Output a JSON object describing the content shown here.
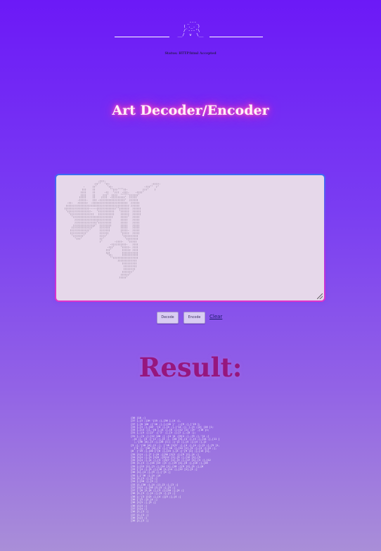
{
  "header": {
    "art": "  _---_\n ( ._. )\n /`---'\\\n__/  v  \\__",
    "status": "Status: HTTP/html Accepted"
  },
  "title": "Art Decoder/Encoder",
  "input": {
    "art": "                         .;;;.\n                      .;;''  ';;.                            .;;;;.\n               .     ;;'       ';;.                     .;;;''  ;'\n              ;;;    ;;          '';;;'''';;.          ;;;'    ;\n             ;;;;    ;;      .;;   ';;;  .;;;.    .;;;;'\n             ;;;;    ;;     ;;;'  ;;;;  '''''';;;;;;'\n            ;;;;;    ;;    ;;;;  .;;;;;;;;;'  ;;;;;\n           .;;;;;.   ;;; .;;;;;;;;;;;;;;;;;'  ;;;;;;\n    .;;.   ;;;;;;;  .;;;;;;;;;;;;;;;;;;;;;;;;  ;;;;;;\n   ;;;;;;;;;;;;;;;;;;;;;;;;;;;;;;;;;;;;;;;;;;; ;;;;;;\n  ;;;;;;;;;;;;;;;;;.....;;;;;;;;;;;;;'';;;;;;;  ;;;;;;\n   ';;;;;;;;;;;;;;;;.   ';;;;;;;;;;;   ';;;;;;  ;;;;;;\n     ';;;;;;;;;;;;;;;;   ;;;;;;;;;;;    ;;;;;;  ;;;;;;\n       ';;;;;;;;;;;;;;;;;;;;;;;;;;;     ;;;;;'  ;;;;;\n         ;;;;;;;;;;;;;;;;;;;;;;;;;      ;;;;;   ;;;;;\n         ;;;;;;;;;;;;;;;';;;;;;;;;      ;;;;;   ;;;;;\n        ;;;;;;;;;;;;;;;'  ;;;;;;;;      ;;;;;   ;;;;;\n       ;;;;;;;;;;;;;;'    ;;;;;;;       ;;;;;   ;;;;;\n      ;;;;;;;;;;;;;'      ;;;;;;;       ;;;;;.  ;;;;;\n      ;;;;;;;;;;;'        ;;;;;;        ';;;;;  ;;;;;\n       ';;;;;;;'          ;;;;'          ';;;;;;;;;;\n         ';;;'            ;;'              ';;;;;;;;\n                          ;'        .;;;;.   ';;;;;\n                                 .;;;;;;;;;;.   ;;;;\n                               .;;;'    ';;;;;. ;;;;\n                              ;;;'       ;;;;;; ;;;;\n                              ;;;        ;;;;;;;;;;;\n                               ';;.      ;;;;;;;;;;;\n                                 '';;;;;;;;;;;;;;;;;\n                                      ;;;;;;;;;;;;;\n                                         ;;;;;;;;;;\n                                          ;;;;;;;;;\n                                          ;;;;;;;;\n                                         ;;;;;;;'\n                                        ;;;;;;'\n                                       ;;;;;'"
  },
  "buttons": {
    "decode": "Decode",
    "encode": "Encode",
    "clear": "Clear"
  },
  "result": {
    "heading": "Result:",
    "output": "[36 ]18 ;]\n[37 ],[3 ;]1H '[15 ;],[36 ],[4 ;],\n[37 ],[8 ]20 ;['16 ;],[;[20 ]'  ;;[9 ;],['19 ];\n[33 ],[3 ;],[16' '[4 ;],[4 ;],['14 ;]; ],[3 ;]2[ [16 ]1;\n[33 ],[13 ;]],'[6 ],[4 ;],[6 ;];[12 ]1[ ;[5' ,[10 ]1;\n[31 ],;[5 ;];[2' ;['2' ;],[3 ;];[7 ],;[5 ;];\n[31 ],;[5 ;];[12 ]20 ;[ ;[4 ]4 ;]5[4 ;],;[9 ;],'[4 ;]\n ,[4 ;], [3 ;]'[2 ;],[3 ;], [20 ]3],[4 ;],[3 ;],[14 ;],[11 ]\n  ;,'[30 ]4],[3 ;],[20 ]1;[ ;['[2 ;],[5 ;];[4 ;],[2\n[3 ;],'[10 ]4],[2 ;], ['18 ]1[3' ;],[4 ;],[4 ;];[2 ;],[9 ]1,\n  ['4 ;],'[16 ]4],[3 ;],['16 ;],[14 ]1],[5 ;],[4 ;];[4 ;],\n[6  ['19 ;],[20 ]'[6 ;],[15 ],[3 ;]'[9 ]1[ ;],[13 ]1],\n[35 ]1[4 ;],[7 ]:[6 ;][30 ]1[2 ;];[9 ]1],[4 ;]\n[34 ]1[4 ;],[3 ]1[6 ;]3[12 ]1],[3 ;],[12 ]1],[3\n[35 ]1[4 ;],[4 ;],[3 ;]3[7 ]1],[3 ;],[17 ]1],[3 ;],[12\n[35 ]1,[3 ;],[16 ]13 ;[3 ;],[19 ]1],[8 ;],[16 ;],[16\n[35 ];[13 ]1],[3 ;],[14 ]1],[18 ;][9 ]1],[5 ;],[6\n[33 ]'[4 ;],[5 ;];[16 ]1,[14 ;],[12 ]1],[3 ;]\n[36 ]1],[4 ;],[9 ;],['[5 ;]\n[35 ],['16 ;],[4 ;]4\n[34 ]1,[3 ;],[3 ;]\n[34 ];[18 ;],[3 ;]\n[33 ]1,[30 ;],[4 ;]1,[3 ;],[3 ;]\n[37 ]2[4 ;],[16 ]1,[5 ;],[5 ;]\n[37 ]'[8 ]1,[8 ;],[3 ;];[10 ;],[4 ;]\n[36 ]1,[3 ;],[4 ;],[5 ;],[3 ;]\n[38 ];'[3 ]1[5 ;],[4 ;][5 ;],[4 ;]\n[36 ]'[3 ;]2,[4 ;]\n[36 ]1[3 ;],[3 ;]\n[36 ]1[4 ;]\n[37 ]1[4 ;]\n[36 ]1,[3 ;]\n[37 ]1,[3 ;]\n[36 ]1[4 ;]\n[36 ]1,[3 ;]"
  }
}
